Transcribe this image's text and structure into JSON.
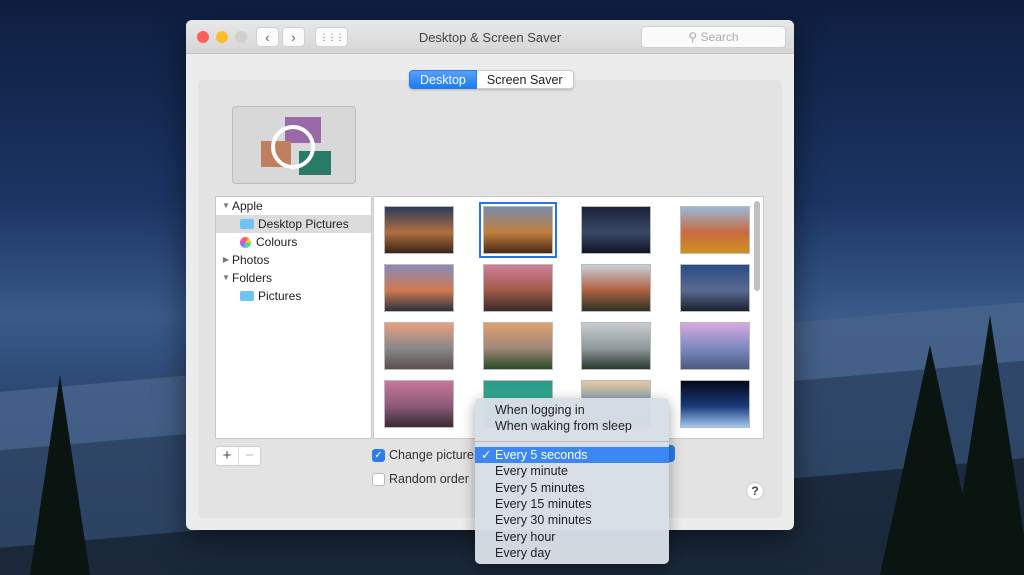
{
  "window": {
    "title": "Desktop & Screen Saver",
    "search_placeholder": "Search",
    "back_label": "‹",
    "forward_label": "›",
    "grid_label": "⋮⋮⋮"
  },
  "tabs": [
    {
      "label": "Desktop",
      "active": true
    },
    {
      "label": "Screen Saver",
      "active": false
    }
  ],
  "sources": [
    {
      "label": "Apple",
      "type": "group",
      "expanded": true
    },
    {
      "label": "Desktop Pictures",
      "type": "folder",
      "selected": true
    },
    {
      "label": "Colours",
      "type": "colours"
    },
    {
      "label": "Photos",
      "type": "group",
      "expanded": false
    },
    {
      "label": "Folders",
      "type": "group",
      "expanded": true
    },
    {
      "label": "Pictures",
      "type": "folder"
    }
  ],
  "thumbnails": [
    {
      "name": "mojave-dynamic",
      "colors": [
        "#2c3a5c",
        "#b07040",
        "#3a2418"
      ]
    },
    {
      "name": "mojave-day",
      "colors": [
        "#7a8aa8",
        "#c08040",
        "#4a2a14"
      ],
      "selected": true
    },
    {
      "name": "mojave-night",
      "colors": [
        "#1a2238",
        "#3a4868",
        "#101626"
      ]
    },
    {
      "name": "high-sierra",
      "colors": [
        "#9ab8d8",
        "#c86a40",
        "#d09020"
      ]
    },
    {
      "name": "sierra",
      "colors": [
        "#8a8ab8",
        "#d07a50",
        "#2a3040"
      ]
    },
    {
      "name": "sierra-2",
      "colors": [
        "#d0809a",
        "#a05a48",
        "#3a2a28"
      ]
    },
    {
      "name": "el-capitan",
      "colors": [
        "#c8d0d8",
        "#b06040",
        "#2a3428"
      ]
    },
    {
      "name": "el-capitan-2",
      "colors": [
        "#2a4a88",
        "#5a6a90",
        "#1a2030"
      ]
    },
    {
      "name": "yosemite",
      "colors": [
        "#e8a080",
        "#8a8888",
        "#5a5050"
      ]
    },
    {
      "name": "yosemite-2",
      "colors": [
        "#e0a070",
        "#a08878",
        "#2a4a28"
      ]
    },
    {
      "name": "yosemite-3",
      "colors": [
        "#c8ccd0",
        "#90989c",
        "#2a3a30"
      ]
    },
    {
      "name": "yosemite-4",
      "colors": [
        "#d8a8e0",
        "#7a8ac0",
        "#4a5a80"
      ]
    },
    {
      "name": "yosemite-5",
      "colors": [
        "#c87898",
        "#8a5a78",
        "#3a2a30"
      ]
    },
    {
      "name": "mavericks",
      "colors": [
        "#2a9a88",
        "#3ab098",
        "#1a6a60"
      ]
    },
    {
      "name": "wave",
      "colors": [
        "#e8c8a0",
        "#6a98b8",
        "#2a5a80"
      ]
    },
    {
      "name": "earth-horizon",
      "colors": [
        "#05081a",
        "#1a3a7a",
        "#a0c8f0"
      ]
    }
  ],
  "controls": {
    "change_picture_label": "Change picture:",
    "change_picture_checked": true,
    "random_order_label": "Random order",
    "random_order_checked": false,
    "add_label": "+",
    "remove_label": "−",
    "help_label": "?"
  },
  "menu": {
    "items_top": [
      "When logging in",
      "When waking from sleep"
    ],
    "items": [
      {
        "label": "Every 5 seconds",
        "selected": true
      },
      {
        "label": "Every minute"
      },
      {
        "label": "Every 5 minutes"
      },
      {
        "label": "Every 15 minutes"
      },
      {
        "label": "Every 30 minutes"
      },
      {
        "label": "Every hour"
      },
      {
        "label": "Every day"
      }
    ],
    "check_glyph": "✓"
  }
}
